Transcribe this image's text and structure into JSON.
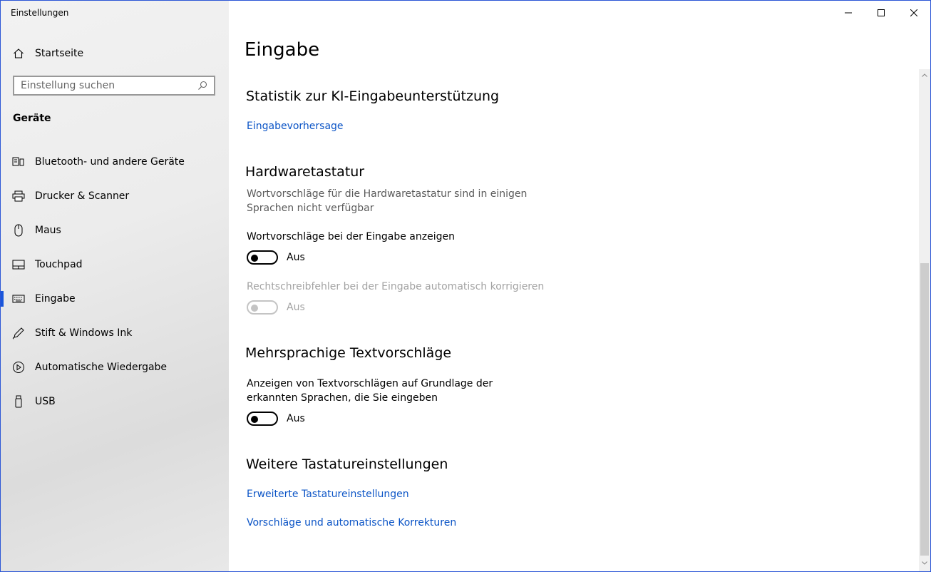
{
  "window": {
    "title": "Einstellungen"
  },
  "sidebar": {
    "home_label": "Startseite",
    "search_placeholder": "Einstellung suchen",
    "section_title": "Geräte",
    "items": [
      {
        "label": "Bluetooth- und andere Geräte",
        "icon": "bluetooth-devices-icon"
      },
      {
        "label": "Drucker & Scanner",
        "icon": "printer-icon"
      },
      {
        "label": "Maus",
        "icon": "mouse-icon"
      },
      {
        "label": "Touchpad",
        "icon": "touchpad-icon"
      },
      {
        "label": "Eingabe",
        "icon": "keyboard-icon",
        "active": true
      },
      {
        "label": "Stift & Windows Ink",
        "icon": "pen-icon"
      },
      {
        "label": "Automatische Wiedergabe",
        "icon": "autoplay-icon"
      },
      {
        "label": "USB",
        "icon": "usb-icon"
      }
    ]
  },
  "main": {
    "page_title": "Eingabe",
    "ai_section": {
      "title": "Statistik zur KI-Eingabeunterstützung",
      "link": "Eingabevorhersage"
    },
    "hardware_section": {
      "title": "Hardwaretastatur",
      "description": "Wortvorschläge für die Hardwaretastatur sind in einigen Sprachen nicht verfügbar",
      "suggestions_label": "Wortvorschläge bei der Eingabe anzeigen",
      "suggestions_state": "Aus",
      "autocorrect_label": "Rechtschreibfehler bei der Eingabe automatisch korrigieren",
      "autocorrect_state": "Aus"
    },
    "multilingual_section": {
      "title": "Mehrsprachige Textvorschläge",
      "label": "Anzeigen von Textvorschlägen auf Grundlage der erkannten Sprachen, die Sie eingeben",
      "state": "Aus"
    },
    "more_section": {
      "title": "Weitere Tastatureinstellungen",
      "link_advanced": "Erweiterte Tastatureinstellungen",
      "link_suggestions": "Vorschläge und automatische Korrekturen"
    }
  },
  "colors": {
    "accent": "#1a56db",
    "link": "#0b54c6",
    "window_border": "#2b56d6"
  }
}
